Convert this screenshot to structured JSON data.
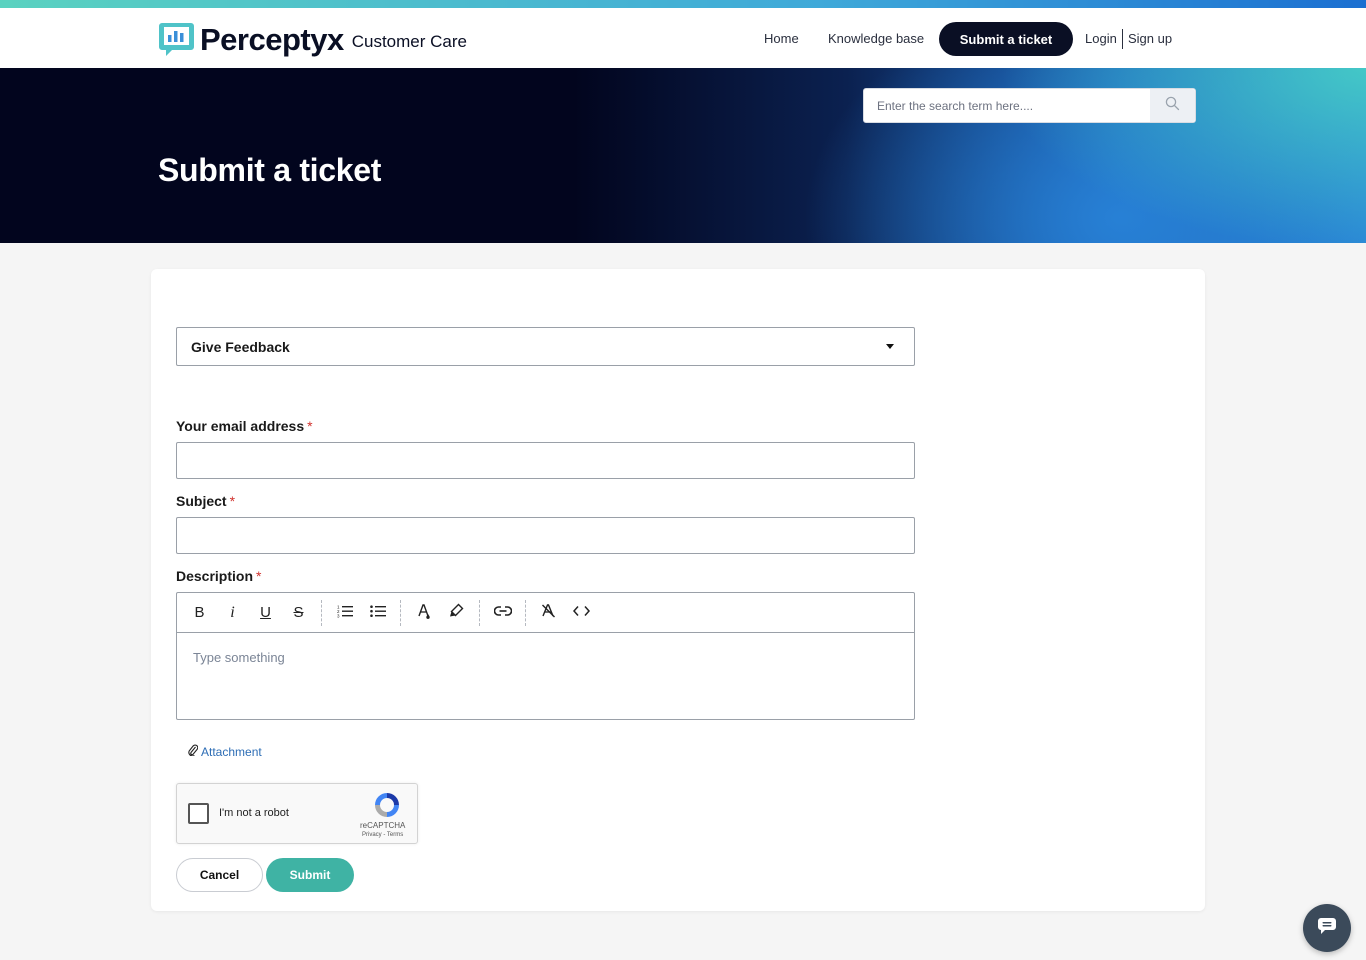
{
  "brand": {
    "name": "Perceptyx",
    "subtitle": "Customer Care",
    "colors": {
      "navy": "#0a0f24",
      "teal": "#3fb3a4",
      "link": "#2d6db5",
      "required": "#d0312d"
    }
  },
  "nav": {
    "home": "Home",
    "knowledge_base": "Knowledge base",
    "submit_ticket": "Submit a ticket",
    "login": "Login",
    "signup": "Sign up"
  },
  "search": {
    "placeholder": "Enter the search term here....",
    "icon": "search-icon"
  },
  "hero": {
    "title": "Submit a ticket"
  },
  "form": {
    "ticket_type": {
      "selected": "Give Feedback",
      "icon": "chevron-down-icon"
    },
    "email": {
      "label": "Your email address",
      "required_mark": "*",
      "value": ""
    },
    "subject": {
      "label": "Subject",
      "required_mark": "*",
      "value": ""
    },
    "description": {
      "label": "Description",
      "required_mark": "*",
      "placeholder": "Type something",
      "toolbar": [
        {
          "name": "bold",
          "glyph": "B"
        },
        {
          "name": "italic",
          "glyph": "i"
        },
        {
          "name": "underline",
          "glyph": "U"
        },
        {
          "name": "strikethrough",
          "glyph": "S"
        },
        {
          "name": "ordered-list",
          "icon": "ordered-list-icon"
        },
        {
          "name": "bullet-list",
          "icon": "bullet-list-icon"
        },
        {
          "name": "text-color",
          "icon": "text-color-icon"
        },
        {
          "name": "highlight",
          "icon": "highlighter-icon"
        },
        {
          "name": "link",
          "icon": "link-icon"
        },
        {
          "name": "clear-format",
          "icon": "clear-format-icon"
        },
        {
          "name": "code",
          "icon": "code-icon"
        }
      ]
    },
    "attachment": {
      "label": "Attachment",
      "icon": "paperclip-icon"
    },
    "captcha": {
      "label": "I'm not a robot",
      "brand": "reCAPTCHA",
      "links": "Privacy - Terms",
      "checked": false
    },
    "cancel_label": "Cancel",
    "submit_label": "Submit"
  },
  "chat_widget": {
    "icon": "chat-icon"
  }
}
